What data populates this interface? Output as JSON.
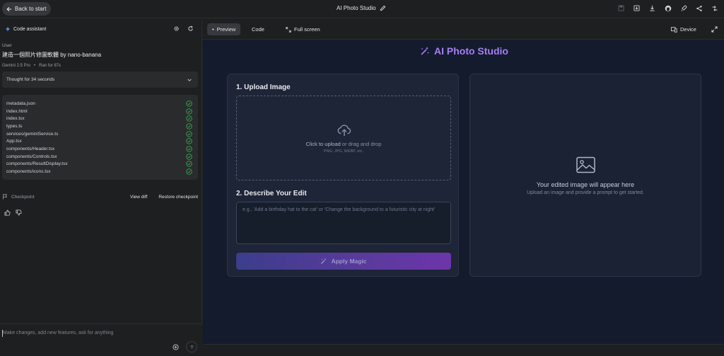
{
  "topbar": {
    "back_label": "Back to start",
    "app_title": "AI Photo Studio",
    "icons": [
      "save-icon",
      "download-icon",
      "github-icon",
      "deploy-icon",
      "share-icon",
      "api-key-icon"
    ]
  },
  "assistant": {
    "title": "Code assistant",
    "user_label": "User",
    "user_message": "建造一個照片修圖軟體 by nano-banana",
    "model": "Gemini 2.5 Pro",
    "ran_for": "Ran for 87s",
    "thought": "Thought for 34 seconds",
    "files": [
      "metadata.json",
      "index.html",
      "index.tsx",
      "types.ts",
      "services/geminiService.ts",
      "App.tsx",
      "components/Header.tsx",
      "components/Controls.tsx",
      "components/ResultDisplay.tsx",
      "components/icons.tsx"
    ],
    "checkpoint_label": "Checkpoint",
    "view_diff": "View diff",
    "restore": "Restore checkpoint",
    "input_placeholder": "Make changes, add new features, ask for anything"
  },
  "tabs": {
    "preview": "Preview",
    "code": "Code",
    "fullscreen": "Full screen",
    "device": "Device"
  },
  "studio": {
    "title": "AI Photo Studio",
    "upload_heading": "1. Upload Image",
    "upload_click": "Click to upload",
    "upload_rest": " or drag and drop",
    "upload_formats": "PNG, JPG, WEBP, etc.",
    "describe_heading": "2. Describe Your Edit",
    "prompt_placeholder": "e.g., 'Add a birthday hat to the cat' or 'Change the background to a futuristic city at night'",
    "apply_label": "Apply Magic",
    "result_title": "Your edited image will appear here",
    "result_sub": "Upload an image and provide a prompt to get started."
  },
  "colors": {
    "accent": "#a67ef5",
    "check": "#34a853",
    "preview_bg": "#141b2d"
  }
}
